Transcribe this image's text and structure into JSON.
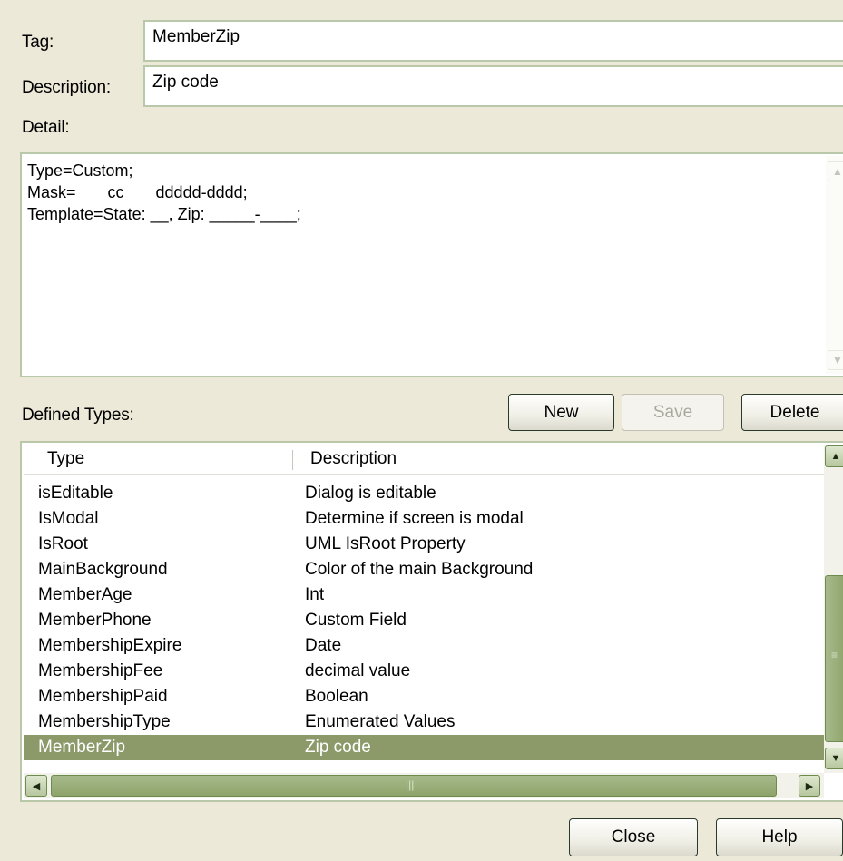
{
  "form": {
    "tag_label": "Tag:",
    "tag_value": "MemberZip",
    "description_label": "Description:",
    "description_value": "Zip code",
    "detail_label": "Detail:",
    "detail_value": "Type=Custom;\nMask=       cc       ddddd-dddd;\nTemplate=State: __, Zip: _____-____;"
  },
  "defined_types": {
    "label": "Defined Types:",
    "buttons": {
      "new": "New",
      "save": "Save",
      "delete": "Delete"
    },
    "columns": [
      "Type",
      "Description"
    ],
    "rows": [
      {
        "type": "isEditable",
        "description": "Dialog is editable"
      },
      {
        "type": "IsModal",
        "description": "Determine if screen is modal"
      },
      {
        "type": "IsRoot",
        "description": "UML IsRoot Property"
      },
      {
        "type": "MainBackground",
        "description": "Color of the main Background"
      },
      {
        "type": "MemberAge",
        "description": "Int"
      },
      {
        "type": "MemberPhone",
        "description": "Custom Field"
      },
      {
        "type": "MembershipExpire",
        "description": "Date"
      },
      {
        "type": "MembershipFee",
        "description": "decimal value"
      },
      {
        "type": "MembershipPaid",
        "description": "Boolean"
      },
      {
        "type": "MembershipType",
        "description": "Enumerated Values"
      },
      {
        "type": "MemberZip",
        "description": "Zip code"
      }
    ],
    "selected_row": "MemberZip"
  },
  "footer": {
    "close": "Close",
    "help": "Help"
  },
  "colors": {
    "dialog_bg": "#ece9d8",
    "selection": "#8c9a6a",
    "scrollbar": "#8ea46b"
  }
}
